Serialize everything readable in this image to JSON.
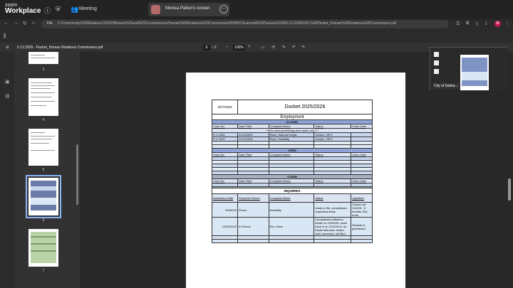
{
  "zoom": {
    "logo_top": "zoom",
    "logo_bottom": "Workplace",
    "meeting_label": "Meeting",
    "share_text": "Monica Patton's screen",
    "share_menu": "⋯"
  },
  "browser": {
    "file_label": "File",
    "url": "C:/Community%20Relations/10%20Boards%20and%20Commissions/Human%20Relations%20Commission/00HRC/Scanned%20Packets/2026/5.12.2026%20-%20Packet_Human%20Relations%20Commission.pdf",
    "profile_initial": "M"
  },
  "pdf": {
    "title": "5.12.2026 - Packet_Human Relations Commission.pdf",
    "page_current": "6",
    "page_total": "/ 9",
    "zoom": "100%"
  },
  "thumbs": [
    {
      "num": "3"
    },
    {
      "num": "4"
    },
    {
      "num": "5"
    },
    {
      "num": "6"
    },
    {
      "num": "7"
    }
  ],
  "docket": {
    "date": "4/27/2026",
    "title": "Docket 2025/2026",
    "section": "Employment",
    "closed_label": "CLOSED",
    "open_label": "OPEN",
    "other_label": "OTHER",
    "inquiries_label": "INQUIRIES",
    "note": "* New case processing year starts July 1 *",
    "headers": [
      "Case No.",
      "Date Filed",
      "Complaint Basis",
      "Status",
      "Close Date"
    ],
    "closed_rows": [
      [
        "E-1-2025",
        "11/13/2025",
        "Race, National Origin",
        "Closed - NPC",
        ""
      ],
      [
        "E-2-2025",
        "11/13/2025",
        "Race, Disability",
        "Closed - NPC",
        ""
      ]
    ],
    "inquiry_headers": [
      "Interaction Date",
      "Phone/In Person",
      "Complaint Basis",
      "Status",
      "Updates?"
    ],
    "inquiry_rows": [
      [
        "5/5/2025",
        "Phone",
        "Disability",
        "ready to file, complainant requested delay",
        "Closed out 11/5/25 - 6 months SOL ends"
      ],
      [
        "12/26/2025",
        "In Person",
        "Sex, Race",
        "Complainant withdrew intake on 12/24/25, came back in on 1/22/26 for an intake interview. Intake held, screened, not filed",
        "Outside of jurisdiction"
      ]
    ]
  },
  "thumbnail_window": {
    "label": "City of Salina..."
  }
}
